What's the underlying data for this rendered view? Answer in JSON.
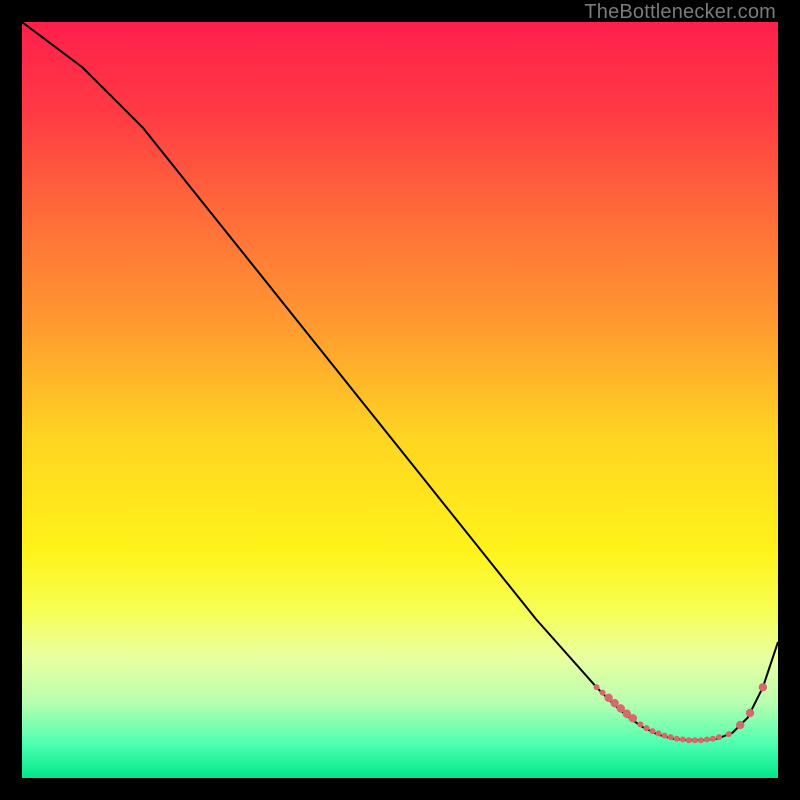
{
  "watermark": "TheBottlenecker.com",
  "chart_data": {
    "type": "line",
    "title": "",
    "xlabel": "",
    "ylabel": "",
    "xlim": [
      0,
      100
    ],
    "ylim": [
      0,
      100
    ],
    "grid": false,
    "legend": false,
    "background_gradient": {
      "stops": [
        {
          "offset": 0.0,
          "color": "#ff1f4b"
        },
        {
          "offset": 0.12,
          "color": "#ff3a44"
        },
        {
          "offset": 0.25,
          "color": "#ff6a3a"
        },
        {
          "offset": 0.4,
          "color": "#ff9a30"
        },
        {
          "offset": 0.55,
          "color": "#ffd522"
        },
        {
          "offset": 0.7,
          "color": "#fff31a"
        },
        {
          "offset": 0.78,
          "color": "#f6ff55"
        },
        {
          "offset": 0.84,
          "color": "#eaffa0"
        },
        {
          "offset": 0.9,
          "color": "#b8ffb0"
        },
        {
          "offset": 0.955,
          "color": "#4dffb0"
        },
        {
          "offset": 1.0,
          "color": "#00e88a"
        }
      ]
    },
    "series": [
      {
        "name": "curve",
        "color": "#000000",
        "x": [
          0,
          4,
          8,
          12,
          16,
          20,
          24,
          28,
          32,
          36,
          40,
          44,
          48,
          52,
          56,
          60,
          64,
          68,
          72,
          76,
          78,
          80,
          82,
          84,
          86,
          88,
          90,
          92,
          94,
          96,
          98,
          100
        ],
        "y": [
          100,
          97,
          94,
          90,
          86,
          81,
          76,
          71,
          66,
          61,
          56,
          51,
          46,
          41,
          36,
          31,
          26,
          21,
          16.5,
          12,
          10,
          8.2,
          6.8,
          5.8,
          5.2,
          5.0,
          5.0,
          5.2,
          6.0,
          8.0,
          12,
          18
        ]
      }
    ],
    "markers": {
      "name": "dots",
      "color": "#d46a6a",
      "radius_small": 3.0,
      "radius_large": 4.2,
      "points": [
        {
          "x": 76.0,
          "y": 12.0,
          "r": "small"
        },
        {
          "x": 76.8,
          "y": 11.3,
          "r": "small"
        },
        {
          "x": 77.6,
          "y": 10.6,
          "r": "large"
        },
        {
          "x": 78.4,
          "y": 9.9,
          "r": "large"
        },
        {
          "x": 79.2,
          "y": 9.2,
          "r": "large"
        },
        {
          "x": 80.0,
          "y": 8.5,
          "r": "large"
        },
        {
          "x": 80.8,
          "y": 7.9,
          "r": "large"
        },
        {
          "x": 81.8,
          "y": 7.1,
          "r": "small"
        },
        {
          "x": 82.6,
          "y": 6.6,
          "r": "small"
        },
        {
          "x": 83.4,
          "y": 6.2,
          "r": "small"
        },
        {
          "x": 84.2,
          "y": 5.9,
          "r": "small"
        },
        {
          "x": 85.0,
          "y": 5.6,
          "r": "small"
        },
        {
          "x": 85.8,
          "y": 5.4,
          "r": "small"
        },
        {
          "x": 86.6,
          "y": 5.2,
          "r": "small"
        },
        {
          "x": 87.4,
          "y": 5.1,
          "r": "small"
        },
        {
          "x": 88.2,
          "y": 5.0,
          "r": "small"
        },
        {
          "x": 89.0,
          "y": 5.0,
          "r": "small"
        },
        {
          "x": 89.8,
          "y": 5.0,
          "r": "small"
        },
        {
          "x": 90.6,
          "y": 5.1,
          "r": "small"
        },
        {
          "x": 91.4,
          "y": 5.2,
          "r": "small"
        },
        {
          "x": 92.2,
          "y": 5.4,
          "r": "small"
        },
        {
          "x": 93.5,
          "y": 5.8,
          "r": "small"
        },
        {
          "x": 95.0,
          "y": 7.0,
          "r": "large"
        },
        {
          "x": 96.3,
          "y": 8.6,
          "r": "large"
        },
        {
          "x": 98.0,
          "y": 12.0,
          "r": "large"
        }
      ]
    }
  }
}
